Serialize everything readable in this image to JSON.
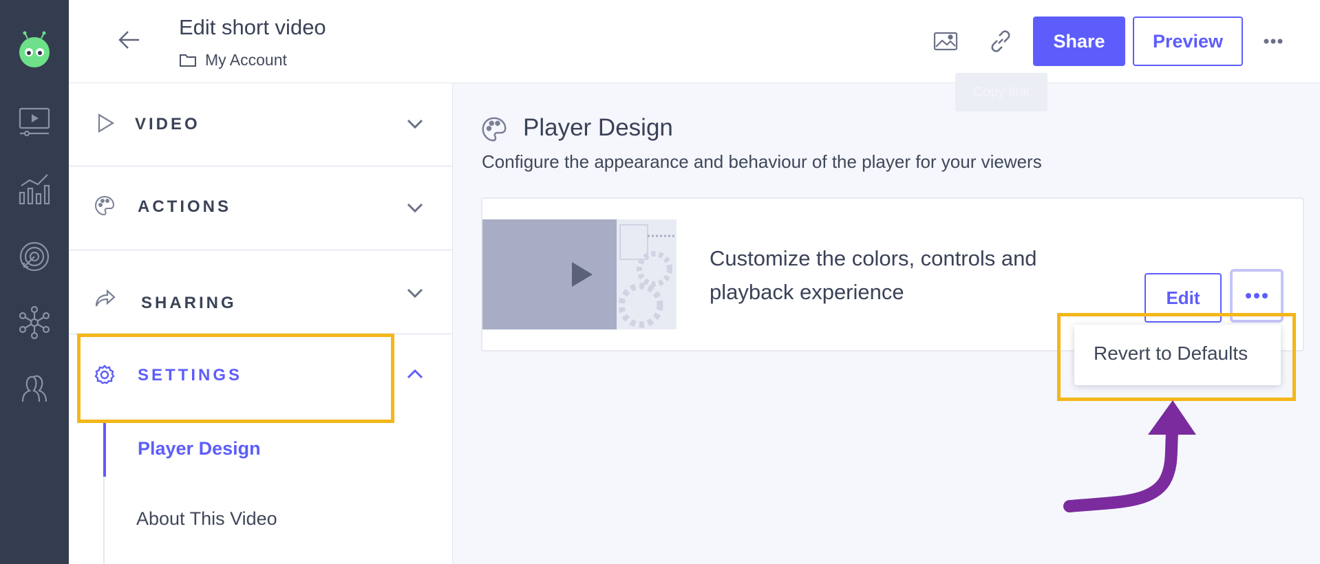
{
  "header": {
    "title": "Edit short video",
    "breadcrumb": "My Account",
    "share_label": "Share",
    "preview_label": "Preview",
    "tooltip": "Copy link",
    "icons": [
      "back-arrow-icon",
      "folder-icon",
      "image-icon",
      "link-icon",
      "more-horizontal-icon"
    ]
  },
  "rail": {
    "icons": [
      "app-logo",
      "video-library-icon",
      "analytics-icon",
      "targeting-icon",
      "integrations-icon",
      "contacts-icon"
    ]
  },
  "sidebar": {
    "sections": [
      {
        "label": "VIDEO",
        "icon": "play-icon",
        "expanded": false
      },
      {
        "label": "ACTIONS",
        "icon": "palette-icon",
        "expanded": false
      },
      {
        "label": "SHARING",
        "icon": "share-arrow-icon",
        "expanded": false
      },
      {
        "label": "SETTINGS",
        "icon": "gear-icon",
        "expanded": true
      }
    ],
    "settings_items": [
      {
        "label": "Player Design",
        "active": true
      },
      {
        "label": "About This Video",
        "active": false
      }
    ]
  },
  "main": {
    "title": "Player Design",
    "subtitle": "Configure the appearance and behaviour of the player for your viewers",
    "card": {
      "text": "Customize the colors, controls and playback experience",
      "edit_label": "Edit"
    },
    "dropdown": {
      "items": [
        "Revert to Defaults"
      ]
    }
  },
  "colors": {
    "accent": "#5d5dfc",
    "rail_bg": "#343d4f",
    "highlight": "#f3b71b",
    "annotation_arrow": "#7b2b9e"
  }
}
